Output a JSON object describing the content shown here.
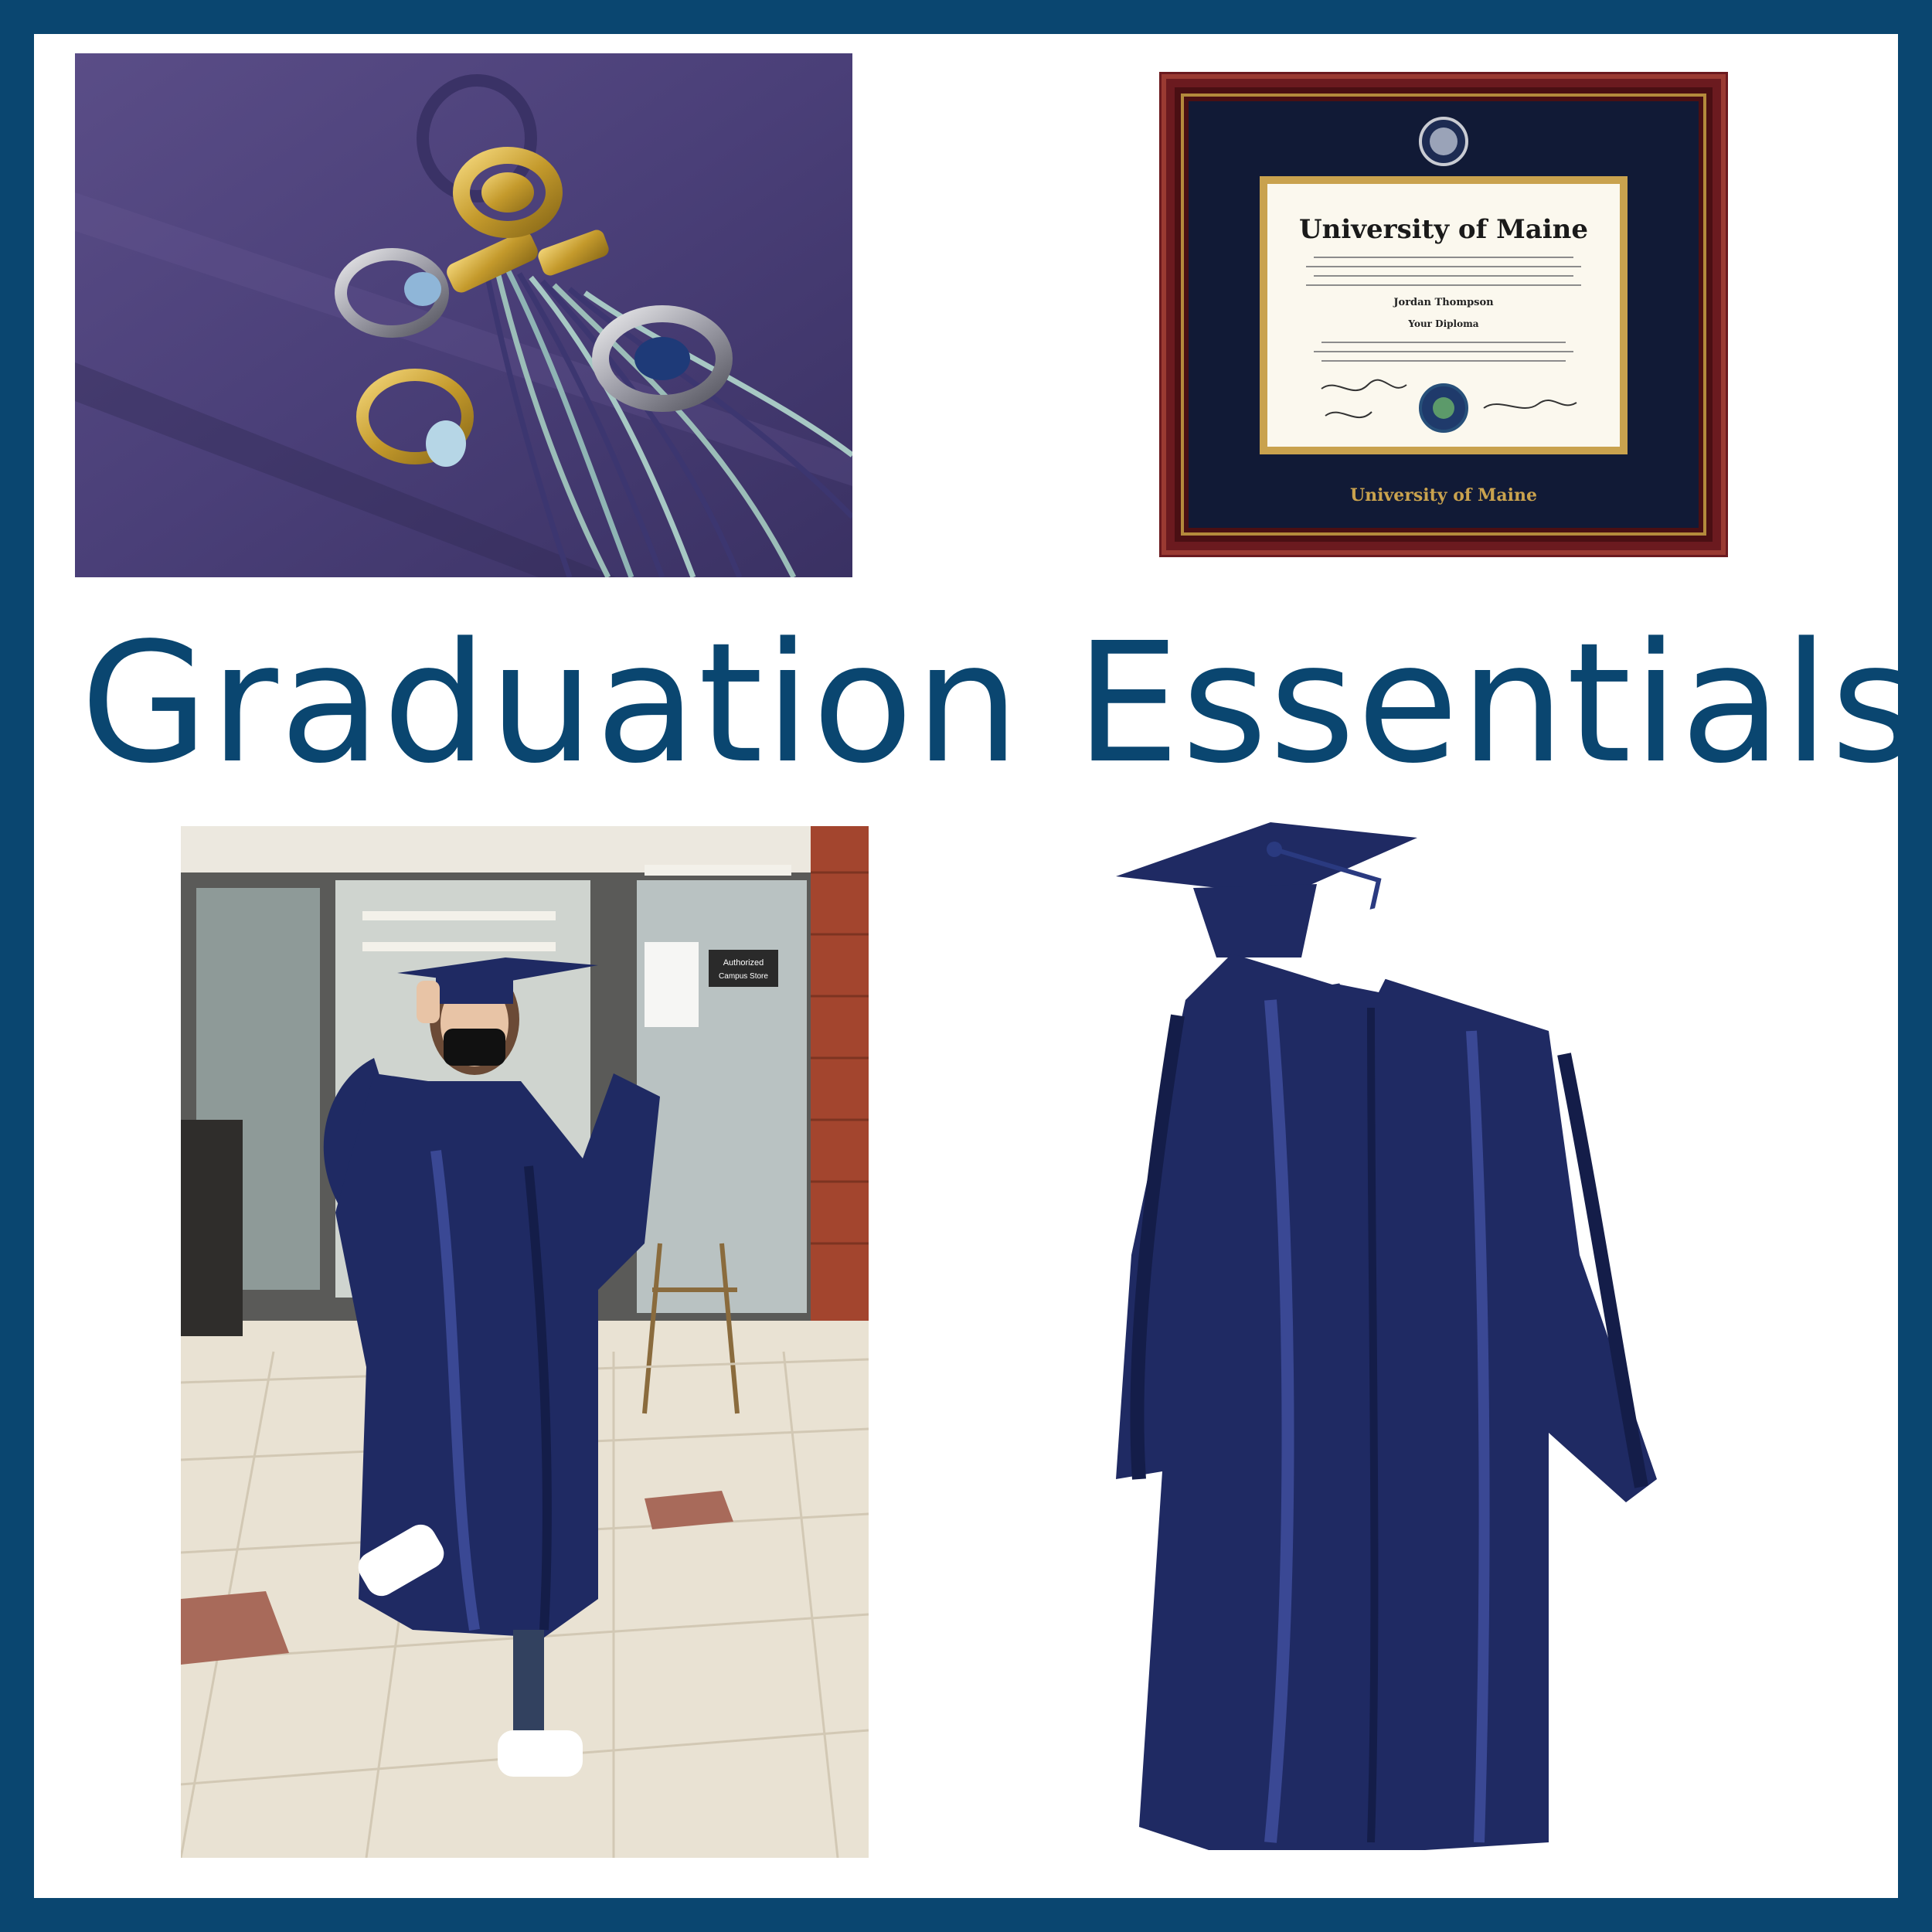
{
  "headline": "Graduation Essentials",
  "diploma": {
    "school_name": "University of Maine",
    "recipient": "Jordan Thompson",
    "degree": "Your Diploma",
    "frame_caption": "University of Maine"
  },
  "store_sign": {
    "brand": "Authorized",
    "subtitle": "Campus Store"
  },
  "colors": {
    "border": "#0a4670",
    "headline": "#0a4670",
    "gown": "#1f2a63",
    "frame": "#6b1a1f"
  }
}
